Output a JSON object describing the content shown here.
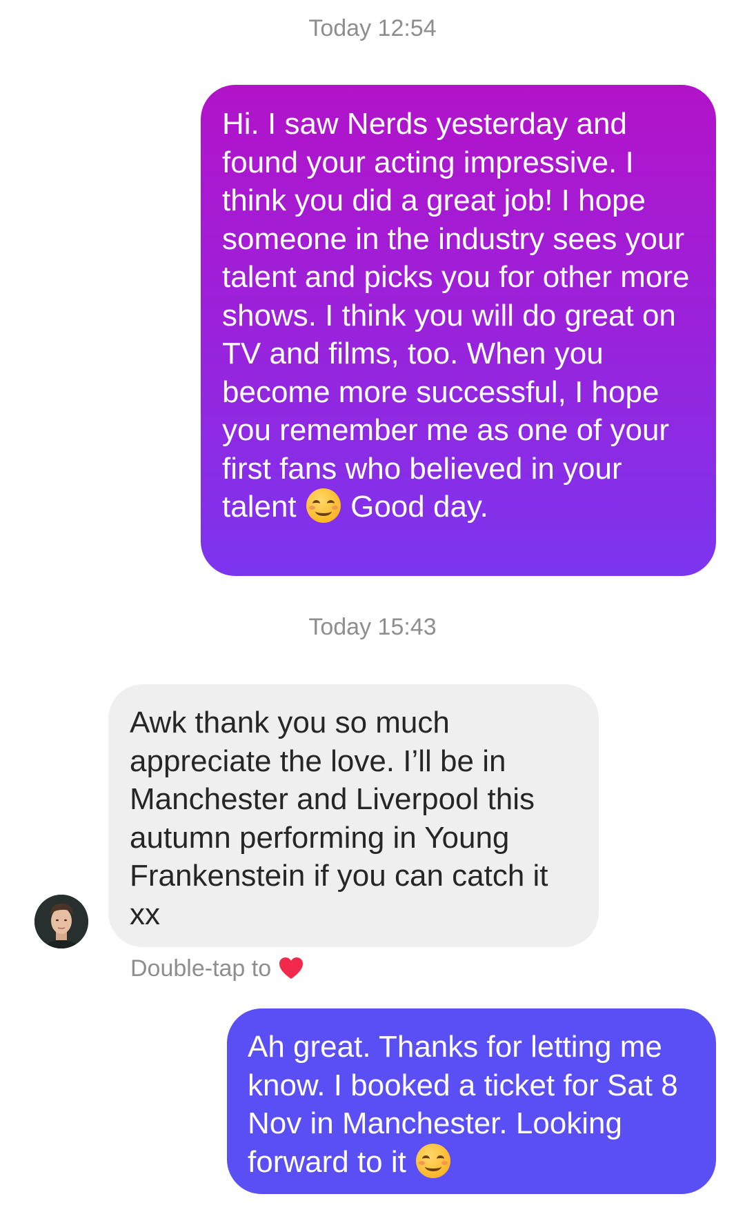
{
  "conversation": {
    "timestamp_1": "Today 12:54",
    "message_1": {
      "text_before_emoji": "Hi. I saw Nerds yesterday and found your acting impressive. I think you did a great job! I hope someone in the industry sees your talent and picks you for other more shows. I think you will do great on TV and films, too. When you become more successful, I hope you remember me as one of your first fans who believed in your talent",
      "emoji": "smiling-face-emoji",
      "text_after_emoji": "Good day."
    },
    "timestamp_2": "Today 15:43",
    "message_2": {
      "text": "Awk thank you so much appreciate the love. I’ll be in Manchester and Liverpool this autumn performing in Young Frankenstein if you can catch it xx"
    },
    "reaction_hint": {
      "label": "Double-tap to",
      "icon": "heart-icon"
    },
    "message_3": {
      "text_before_emoji": "Ah great. Thanks for letting me know. I booked a ticket for Sat 8 Nov in Manchester. Looking forward to it",
      "emoji": "smiling-face-emoji"
    }
  },
  "colors": {
    "outgoing_gradient_top": "#b213c9",
    "outgoing_gradient_bottom": "#7c35ef",
    "outgoing_solid": "#5a4ff4",
    "incoming_bg": "#efefef",
    "incoming_text": "#262626",
    "timestamp_text": "#8e8e8e",
    "heart": "#f2294b"
  }
}
